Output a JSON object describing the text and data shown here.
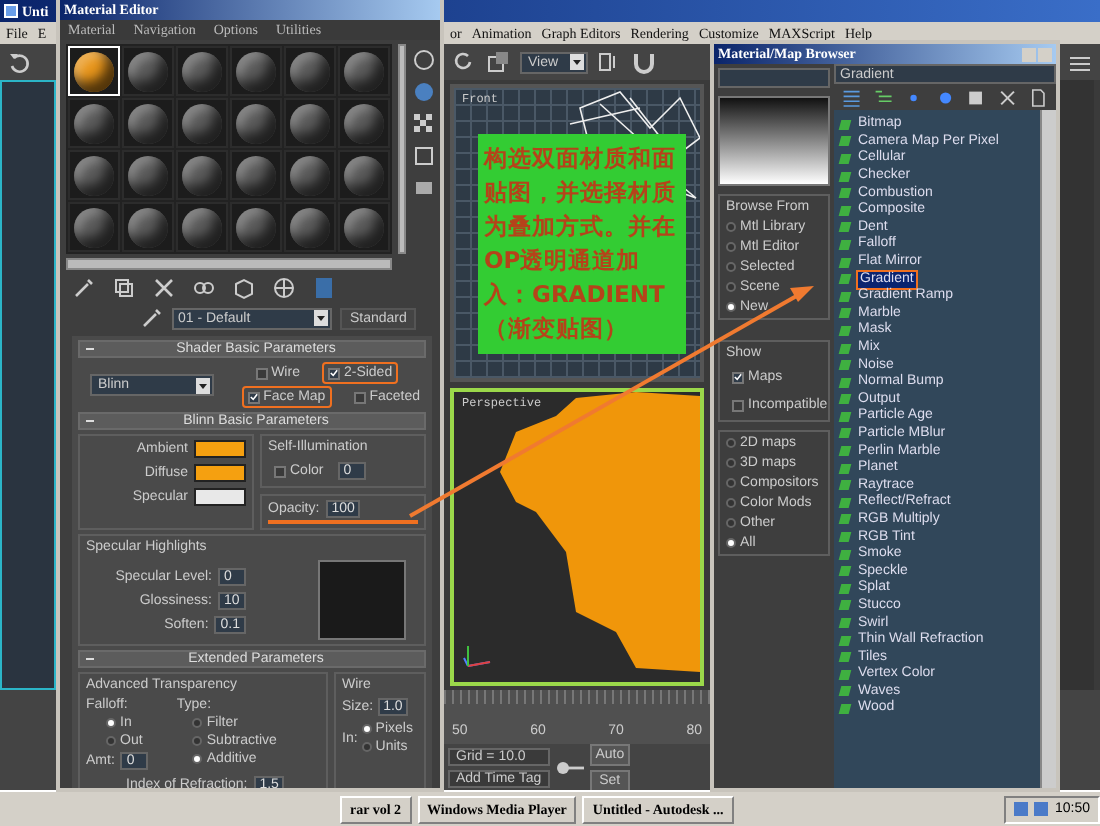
{
  "main_window": {
    "title": "Unti",
    "menu_left": [
      "File",
      "E"
    ],
    "menu_right": [
      "or",
      "Animation",
      "Graph Editors",
      "Rendering",
      "Customize",
      "MAXScript",
      "Help"
    ],
    "view_dropdown": "View",
    "viewports": [
      {
        "label": "Front"
      },
      {
        "label": "Perspective"
      }
    ],
    "timeline_ticks": [
      "50",
      "60",
      "70",
      "80"
    ],
    "grid": "Grid = 10.0",
    "add_time_tag": "Add Time Tag",
    "auto_button": "Auto",
    "set_button": "Set"
  },
  "annotation": {
    "text": "构选双面材质和面贴图，并选择材质为叠加方式。并在OP透明通道加入：GRADIENT（渐变贴图）"
  },
  "material_editor": {
    "title": "Material Editor",
    "menu": [
      "Material",
      "Navigation",
      "Options",
      "Utilities"
    ],
    "slots": [
      {
        "selected": true,
        "color": "#e8961c"
      },
      {
        "selected": false,
        "color": "#5c5c5c"
      },
      {
        "selected": false,
        "color": "#5c5c5c"
      },
      {
        "selected": false,
        "color": "#5c5c5c"
      },
      {
        "selected": false,
        "color": "#5c5c5c"
      },
      {
        "selected": false,
        "color": "#5c5c5c"
      },
      {
        "selected": false,
        "color": "#5c5c5c"
      },
      {
        "selected": false,
        "color": "#5c5c5c"
      },
      {
        "selected": false,
        "color": "#5c5c5c"
      },
      {
        "selected": false,
        "color": "#5c5c5c"
      },
      {
        "selected": false,
        "color": "#5c5c5c"
      },
      {
        "selected": false,
        "color": "#5c5c5c"
      },
      {
        "selected": false,
        "color": "#5c5c5c"
      },
      {
        "selected": false,
        "color": "#5c5c5c"
      },
      {
        "selected": false,
        "color": "#5c5c5c"
      },
      {
        "selected": false,
        "color": "#5c5c5c"
      },
      {
        "selected": false,
        "color": "#5c5c5c"
      },
      {
        "selected": false,
        "color": "#5c5c5c"
      },
      {
        "selected": false,
        "color": "#5c5c5c"
      },
      {
        "selected": false,
        "color": "#5c5c5c"
      },
      {
        "selected": false,
        "color": "#5c5c5c"
      },
      {
        "selected": false,
        "color": "#5c5c5c"
      },
      {
        "selected": false,
        "color": "#5c5c5c"
      },
      {
        "selected": false,
        "color": "#5c5c5c"
      }
    ],
    "material_name": "01 - Default",
    "material_type": "Standard",
    "shader_rollout": {
      "title": "Shader Basic Parameters",
      "shader": "Blinn",
      "options": [
        {
          "label": "Wire",
          "checked": false,
          "highlighted": false
        },
        {
          "label": "2-Sided",
          "checked": true,
          "highlighted": true
        },
        {
          "label": "Face Map",
          "checked": true,
          "highlighted": true
        },
        {
          "label": "Faceted",
          "checked": false,
          "highlighted": false
        }
      ]
    },
    "blinn_rollout": {
      "title": "Blinn Basic Parameters",
      "colors": [
        {
          "label": "Ambient",
          "color": "#f5a010"
        },
        {
          "label": "Diffuse",
          "color": "#f5a010"
        },
        {
          "label": "Specular",
          "color": "#e8e8e8"
        }
      ],
      "self_illumination": {
        "title": "Self-Illumination",
        "label": "Color",
        "checked": false,
        "value": "0"
      },
      "opacity": {
        "label": "Opacity:",
        "value": "100",
        "highlighted": true
      },
      "specular_highlights": {
        "title": "Specular Highlights",
        "fields": [
          {
            "label": "Specular Level:",
            "value": "0"
          },
          {
            "label": "Glossiness:",
            "value": "10"
          },
          {
            "label": "Soften:",
            "value": "0.1"
          }
        ]
      }
    },
    "extended_rollout": {
      "title": "Extended Parameters",
      "advanced_transparency": {
        "title": "Advanced Transparency",
        "falloff_label": "Falloff:",
        "falloff": [
          {
            "label": "In",
            "selected": true
          },
          {
            "label": "Out",
            "selected": false
          }
        ],
        "type_label": "Type:",
        "types": [
          {
            "label": "Filter",
            "selected": false
          },
          {
            "label": "Subtractive",
            "selected": false
          },
          {
            "label": "Additive",
            "selected": true
          }
        ],
        "amount_label": "Amt:",
        "amount": "0",
        "ior_label": "Index of Refraction:",
        "ior": "1.5"
      },
      "wire": {
        "title": "Wire",
        "size_label": "Size:",
        "size": "1.0",
        "in_label": "In:",
        "units": [
          {
            "label": "Pixels",
            "selected": true
          },
          {
            "label": "Units",
            "selected": false
          }
        ]
      }
    }
  },
  "browser": {
    "title": "Material/Map Browser",
    "search": "Gradient",
    "browse_from": {
      "title": "Browse From",
      "options": [
        {
          "label": "Mtl Library",
          "selected": false
        },
        {
          "label": "Mtl Editor",
          "selected": false
        },
        {
          "label": "Selected",
          "selected": false
        },
        {
          "label": "Scene",
          "selected": false
        },
        {
          "label": "New",
          "selected": true
        }
      ]
    },
    "show": {
      "title": "Show",
      "options": [
        {
          "label": "Maps",
          "checked": true
        },
        {
          "label": "Incompatible",
          "checked": false
        }
      ]
    },
    "categories": [
      {
        "label": "2D maps",
        "selected": false
      },
      {
        "label": "3D maps",
        "selected": false
      },
      {
        "label": "Compositors",
        "selected": false
      },
      {
        "label": "Color Mods",
        "selected": false
      },
      {
        "label": "Other",
        "selected": false
      },
      {
        "label": "All",
        "selected": true
      }
    ],
    "maps": [
      {
        "label": "Bitmap",
        "selected": false
      },
      {
        "label": "Camera Map Per Pixel",
        "selected": false
      },
      {
        "label": "Cellular",
        "selected": false
      },
      {
        "label": "Checker",
        "selected": false
      },
      {
        "label": "Combustion",
        "selected": false
      },
      {
        "label": "Composite",
        "selected": false
      },
      {
        "label": "Dent",
        "selected": false
      },
      {
        "label": "Falloff",
        "selected": false
      },
      {
        "label": "Flat Mirror",
        "selected": false
      },
      {
        "label": "Gradient",
        "selected": true
      },
      {
        "label": "Gradient Ramp",
        "selected": false
      },
      {
        "label": "Marble",
        "selected": false
      },
      {
        "label": "Mask",
        "selected": false
      },
      {
        "label": "Mix",
        "selected": false
      },
      {
        "label": "Noise",
        "selected": false
      },
      {
        "label": "Normal Bump",
        "selected": false
      },
      {
        "label": "Output",
        "selected": false
      },
      {
        "label": "Particle Age",
        "selected": false
      },
      {
        "label": "Particle MBlur",
        "selected": false
      },
      {
        "label": "Perlin Marble",
        "selected": false
      },
      {
        "label": "Planet",
        "selected": false
      },
      {
        "label": "Raytrace",
        "selected": false
      },
      {
        "label": "Reflect/Refract",
        "selected": false
      },
      {
        "label": "RGB Multiply",
        "selected": false
      },
      {
        "label": "RGB Tint",
        "selected": false
      },
      {
        "label": "Smoke",
        "selected": false
      },
      {
        "label": "Speckle",
        "selected": false
      },
      {
        "label": "Splat",
        "selected": false
      },
      {
        "label": "Stucco",
        "selected": false
      },
      {
        "label": "Swirl",
        "selected": false
      },
      {
        "label": "Thin Wall Refraction",
        "selected": false
      },
      {
        "label": "Tiles",
        "selected": false
      },
      {
        "label": "Vertex Color",
        "selected": false
      },
      {
        "label": "Waves",
        "selected": false
      },
      {
        "label": "Wood",
        "selected": false
      }
    ]
  },
  "taskbar": {
    "items": [
      "rar vol 2",
      "Windows Media Player",
      "Untitled - Autodesk ..."
    ],
    "clock": "10:50"
  }
}
